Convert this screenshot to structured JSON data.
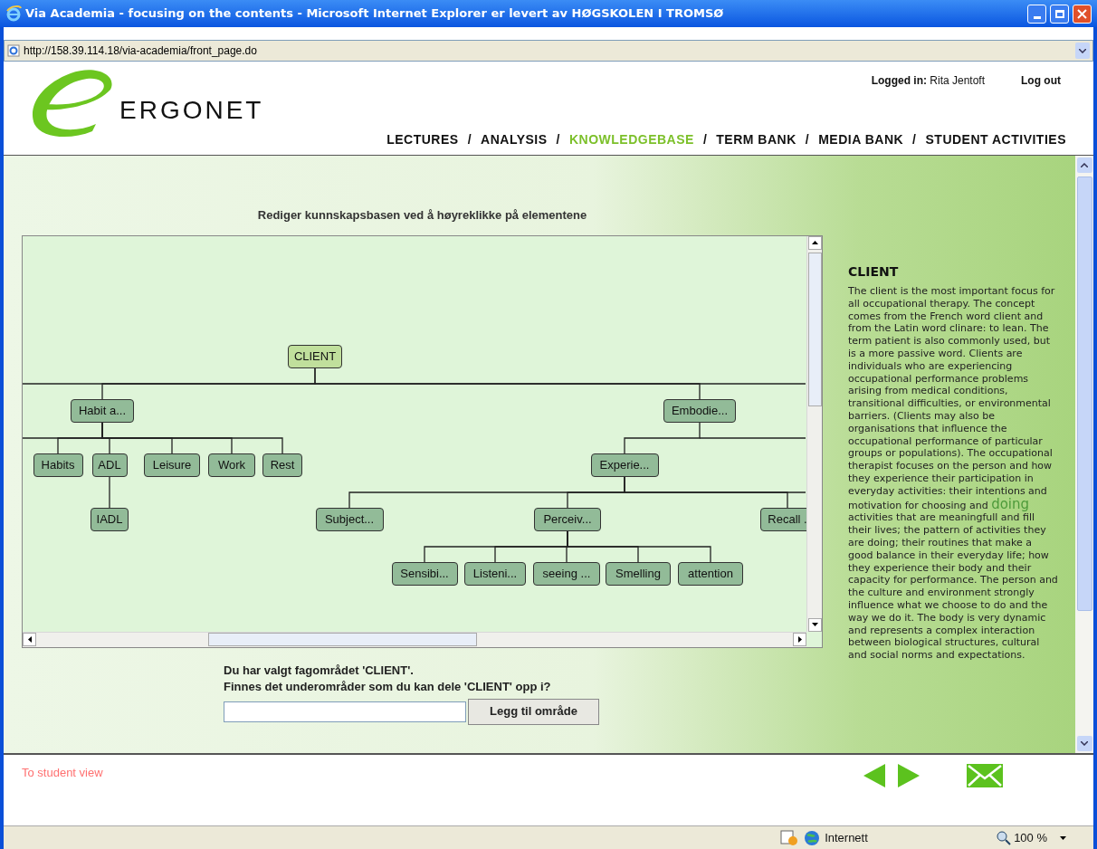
{
  "window": {
    "title": "Via Academia - focusing on the contents - Microsoft Internet Explorer er levert av HØGSKOLEN I TROMSØ"
  },
  "address_bar": {
    "url": "http://158.39.114.18/via-academia/front_page.do"
  },
  "header": {
    "logo_text": "ERGONET",
    "logged_in_label": "Logged in:",
    "user": "Rita Jentoft",
    "logout": "Log out",
    "nav": [
      {
        "label": "LECTURES",
        "selected": false
      },
      {
        "label": "ANALYSIS",
        "selected": false
      },
      {
        "label": "KNOWLEDGEBASE",
        "selected": true
      },
      {
        "label": "TERM BANK",
        "selected": false
      },
      {
        "label": "MEDIA BANK",
        "selected": false
      },
      {
        "label": "STUDENT ACTIVITIES",
        "selected": false
      }
    ],
    "separator": "/"
  },
  "editor": {
    "heading": "Rediger kunnskapsbasen ved å høyreklikke på elementene",
    "tree": {
      "label": "CLIENT",
      "selected": true,
      "children": [
        {
          "label": "Habit a...",
          "selected": false,
          "children": [
            {
              "label": "Habits",
              "selected": false
            },
            {
              "label": "ADL",
              "selected": false,
              "children": [
                {
                  "label": "IADL",
                  "selected": false
                }
              ]
            },
            {
              "label": "Leisure",
              "selected": false
            },
            {
              "label": "Work",
              "selected": false
            },
            {
              "label": "Rest",
              "selected": false
            }
          ]
        },
        {
          "label": "Embodie...",
          "selected": false,
          "children": [
            {
              "label": "Experie...",
              "selected": false,
              "children": [
                {
                  "label": "Subject...",
                  "selected": false
                },
                {
                  "label": "Perceiv...",
                  "selected": false,
                  "children": [
                    {
                      "label": "Sensibi...",
                      "selected": false
                    },
                    {
                      "label": "Listeni...",
                      "selected": false
                    },
                    {
                      "label": "seeing ...",
                      "selected": false
                    },
                    {
                      "label": "Smelling",
                      "selected": false
                    },
                    {
                      "label": "attention",
                      "selected": false
                    }
                  ]
                },
                {
                  "label": "Recall .",
                  "selected": false
                }
              ]
            }
          ]
        }
      ]
    },
    "prompt_lines": [
      "Du har valgt fagområdet 'CLIENT'.",
      "Finnes det underområder som du kan dele 'CLIENT' opp i?"
    ],
    "add_button": "Legg til område"
  },
  "description": {
    "title": "CLIENT",
    "segments": [
      {
        "kind": "plain",
        "text": "The client is the most important focus for all occupational therapy. The concept comes from the French word client and from the Latin word clinare: to lean. The term patient is also commonly used, but is a more passive word. Clients are individuals who are experiencing occupational performance problems arising from medical conditions, transitional difficulties, or environmental barriers. (Clients may also be organisations that influence the occupational performance of particular groups or populations). The occupational therapist focuses on the person and how they experience their participation in everyday activities: their intentions and motivation for choosing and "
      },
      {
        "kind": "emphasis",
        "text": "doing"
      },
      {
        "kind": "plain",
        "text": " activities that are meaningfull and fill their lives; the pattern of activities they are doing; their routines that make a good balance in their everyday life; how they experience their body and their capacity for performance. The person and the culture and environment strongly influence what we choose to do and the way we do it. The body is very dynamic and represents a complex interaction between biological structures, cultural and social norms and expectations."
      }
    ]
  },
  "footer": {
    "student_view_link": "To student view"
  },
  "status_bar": {
    "zone": "Internett",
    "zoom": "100 %"
  }
}
